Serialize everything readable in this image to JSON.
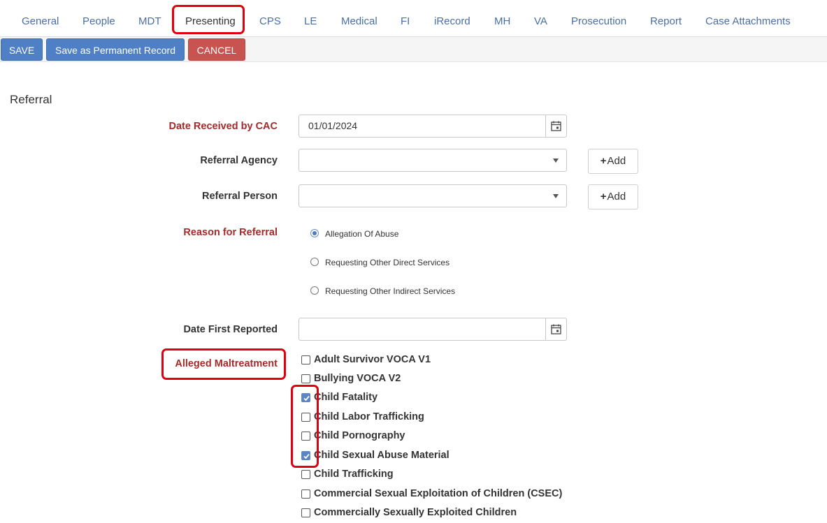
{
  "tabs": [
    {
      "label": "General"
    },
    {
      "label": "People"
    },
    {
      "label": "MDT"
    },
    {
      "label": "Presenting"
    },
    {
      "label": "CPS"
    },
    {
      "label": "LE"
    },
    {
      "label": "Medical"
    },
    {
      "label": "FI"
    },
    {
      "label": "iRecord"
    },
    {
      "label": "MH"
    },
    {
      "label": "VA"
    },
    {
      "label": "Prosecution"
    },
    {
      "label": "Report"
    },
    {
      "label": "Case Attachments"
    }
  ],
  "active_tab": "Presenting",
  "toolbar": {
    "save": "SAVE",
    "save_permanent": "Save as Permanent Record",
    "cancel": "CANCEL"
  },
  "section": {
    "title": "Referral"
  },
  "form": {
    "date_received": {
      "label": "Date Received by CAC",
      "value": "01/01/2024"
    },
    "referral_agency": {
      "label": "Referral Agency",
      "value": "",
      "add_label": "Add"
    },
    "referral_person": {
      "label": "Referral Person",
      "value": "",
      "add_label": "Add"
    },
    "reason": {
      "label": "Reason for Referral",
      "options": [
        {
          "label": "Allegation Of Abuse",
          "selected": true
        },
        {
          "label": "Requesting Other Direct Services",
          "selected": false
        },
        {
          "label": "Requesting Other Indirect Services",
          "selected": false
        }
      ]
    },
    "date_first_reported": {
      "label": "Date First Reported",
      "value": ""
    },
    "alleged_maltreatment": {
      "label": "Alleged Maltreatment",
      "options": [
        {
          "label": "Adult Survivor VOCA V1",
          "checked": false
        },
        {
          "label": "Bullying VOCA V2",
          "checked": false
        },
        {
          "label": "Child Fatality",
          "checked": true
        },
        {
          "label": "Child Labor Trafficking",
          "checked": false
        },
        {
          "label": "Child Pornography",
          "checked": false
        },
        {
          "label": "Child Sexual Abuse Material",
          "checked": true
        },
        {
          "label": "Child Trafficking",
          "checked": false
        },
        {
          "label": "Commercial Sexual Exploitation of Children (CSEC)",
          "checked": false
        },
        {
          "label": "Commercially Sexually Exploited Children",
          "checked": false
        }
      ]
    }
  },
  "colors": {
    "primary": "#4f7fc4",
    "danger": "#c9534e",
    "required_label": "#a52a2a",
    "highlight": "#e0000f",
    "tab_link": "#4a6fa5"
  }
}
